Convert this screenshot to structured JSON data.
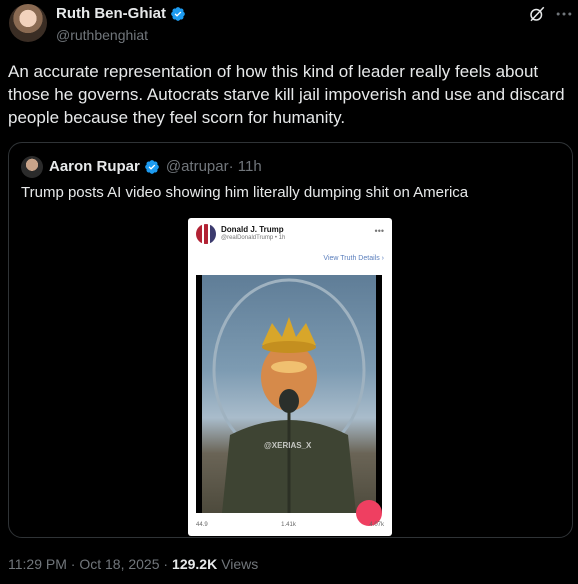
{
  "author": {
    "display_name": "Ruth Ben-Ghiat",
    "handle": "@ruthbenghiat",
    "verified_icon": "verified-badge-icon"
  },
  "tweet": {
    "text": "An accurate representation of how this kind of leader really feels about those he governs. Autocrats starve kill jail impoverish and use and discard people  because they feel scorn for humanity."
  },
  "quote": {
    "display_name": "Aaron Rupar",
    "handle": "@atrupar",
    "time": " · 11h",
    "text": "Trump posts AI video showing him literally dumping shit on America",
    "media": {
      "poster_name": "Donald J. Trump",
      "poster_handle": "@realDonaldTrump • 1h",
      "link_text": "View Truth Details",
      "watermark": "@XERIAS_X",
      "stats": [
        "44.9",
        "1.41k",
        "4.07k"
      ]
    }
  },
  "footer": {
    "time": "11:29 PM · Oct 18, 2025 · ",
    "views_count": "129.2K",
    "views_label": "Views"
  },
  "colors": {
    "background": "#000000",
    "text": "#e7e9ea",
    "muted": "#71767b",
    "verified": "#1d9bf0",
    "border": "#2f3336"
  }
}
